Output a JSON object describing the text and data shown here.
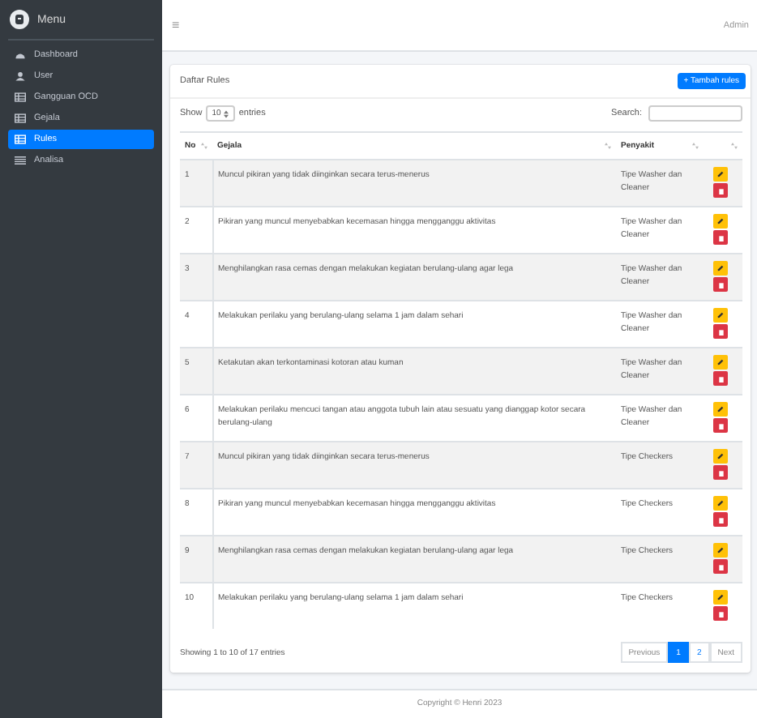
{
  "sidebar": {
    "title": "Menu",
    "items": [
      {
        "label": "Dashboard",
        "selected": false
      },
      {
        "label": "User",
        "selected": false
      },
      {
        "label": "Gangguan OCD",
        "selected": false
      },
      {
        "label": "Gejala",
        "selected": false
      },
      {
        "label": "Rules",
        "selected": true
      },
      {
        "label": "Analisa",
        "selected": false
      }
    ]
  },
  "topbar": {
    "menu_icon": "≡",
    "user": "Admin"
  },
  "card": {
    "title": "Daftar Rules",
    "add_button": "+ Tambah rules",
    "length": {
      "before": "Show",
      "value": "10",
      "after": "entries"
    },
    "search_label": "Search:",
    "table": {
      "columns": [
        "No",
        "Gejala",
        "Penyakit",
        ""
      ],
      "rows": [
        {
          "no": "1",
          "gejala": "Muncul pikiran yang tidak diinginkan secara terus-menerus",
          "penyakit": "Tipe Washer dan Cleaner"
        },
        {
          "no": "2",
          "gejala": "Pikiran yang muncul menyebabkan kecemasan hingga mengganggu aktivitas",
          "penyakit": "Tipe Washer dan Cleaner"
        },
        {
          "no": "3",
          "gejala": "Menghilangkan rasa cemas dengan melakukan kegiatan berulang-ulang agar lega",
          "penyakit": "Tipe Washer dan Cleaner"
        },
        {
          "no": "4",
          "gejala": "Melakukan perilaku yang berulang-ulang selama 1 jam dalam sehari",
          "penyakit": "Tipe Washer dan Cleaner"
        },
        {
          "no": "5",
          "gejala": "Ketakutan akan terkontaminasi kotoran atau kuman",
          "penyakit": "Tipe Washer dan Cleaner"
        },
        {
          "no": "6",
          "gejala": "Melakukan perilaku mencuci tangan atau anggota tubuh lain atau sesuatu yang dianggap kotor secara berulang-ulang",
          "penyakit": "Tipe Washer dan Cleaner"
        },
        {
          "no": "7",
          "gejala": "Muncul pikiran yang tidak diinginkan secara terus-menerus",
          "penyakit": "Tipe Checkers"
        },
        {
          "no": "8",
          "gejala": "Pikiran yang muncul menyebabkan kecemasan hingga mengganggu aktivitas",
          "penyakit": "Tipe Checkers"
        },
        {
          "no": "9",
          "gejala": "Menghilangkan rasa cemas dengan melakukan kegiatan berulang-ulang agar lega",
          "penyakit": "Tipe Checkers"
        },
        {
          "no": "10",
          "gejala": "Melakukan perilaku yang berulang-ulang selama 1 jam dalam sehari",
          "penyakit": "Tipe Checkers"
        }
      ]
    },
    "info": "Showing 1 to 10 of 17 entries",
    "pagination": [
      {
        "label": "Previous",
        "kind": "nav",
        "selected": false
      },
      {
        "label": "1",
        "kind": "page",
        "selected": true
      },
      {
        "label": "2",
        "kind": "page",
        "selected": false
      },
      {
        "label": "Next",
        "kind": "nav",
        "selected": false
      }
    ]
  },
  "footer": "Copyright © Henri 2023"
}
